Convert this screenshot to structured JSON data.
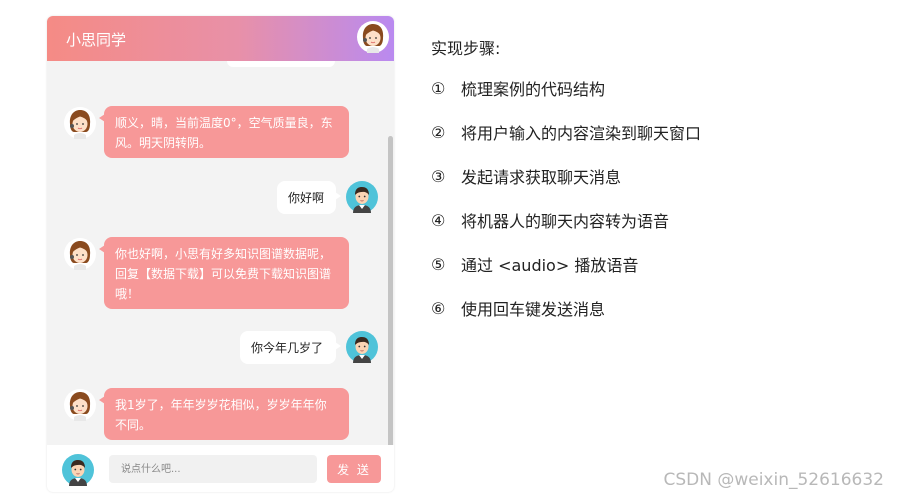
{
  "chat": {
    "title": "小思同学",
    "input_placeholder": "说点什么吧...",
    "send_label": "发 送",
    "messages": [
      {
        "from": "bot",
        "text": "顺义，晴，当前温度0°，空气质量良，东风。明天阴转阴。"
      },
      {
        "from": "user",
        "text": "你好啊"
      },
      {
        "from": "bot",
        "text": "你也好啊，小思有好多知识图谱数据呢，回复【数据下载】可以免费下载知识图谱哦！"
      },
      {
        "from": "user",
        "text": "你今年几岁了"
      },
      {
        "from": "bot",
        "text": "我1岁了，年年岁岁花相似，岁岁年年你不同。"
      }
    ]
  },
  "steps": {
    "title": "实现步骤:",
    "items": [
      {
        "num": "①",
        "text": "梳理案例的代码结构"
      },
      {
        "num": "②",
        "text": "将用户输入的内容渲染到聊天窗口"
      },
      {
        "num": "③",
        "text": "发起请求获取聊天消息"
      },
      {
        "num": "④",
        "text": "将机器人的聊天内容转为语音"
      },
      {
        "num": "⑤",
        "text": "通过 <audio> 播放语音"
      },
      {
        "num": "⑥",
        "text": "使用回车键发送消息"
      }
    ]
  },
  "watermark": "CSDN @weixin_52616632",
  "icons": {
    "bot_avatar": "girl-avatar-icon",
    "user_avatar": "boy-avatar-icon"
  },
  "colors": {
    "bubble_bot": "#f79898",
    "header_start": "#f58b85",
    "header_end": "#b98af0"
  }
}
